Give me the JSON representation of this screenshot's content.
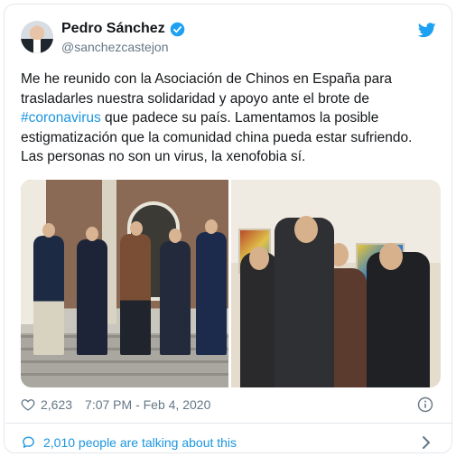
{
  "author": {
    "display_name": "Pedro Sánchez",
    "handle": "@sanchezcastejon",
    "verified": true
  },
  "tweet": {
    "text_before": "Me he reunido con la Asociación de Chinos en España para trasladarles nuestra solidaridad y apoyo ante el brote de ",
    "hashtag": "#coronavirus",
    "text_after": " que padece su país. Lamentamos la posible estigmatización que la comunidad china pueda estar sufriendo. Las personas no son un virus, la xenofobia sí."
  },
  "meta": {
    "like_count": "2,623",
    "timestamp": "7:07 PM - Feb 4, 2020"
  },
  "footer": {
    "talking_label": "2,010 people are talking about this"
  },
  "colors": {
    "accent": "#1b95e0",
    "text": "#14171a",
    "muted": "#657786",
    "border": "#e1e8ed"
  },
  "icons": [
    "verified-badge-icon",
    "twitter-bird-icon",
    "heart-icon",
    "info-icon",
    "comment-bubble-icon",
    "chevron-right-icon"
  ]
}
